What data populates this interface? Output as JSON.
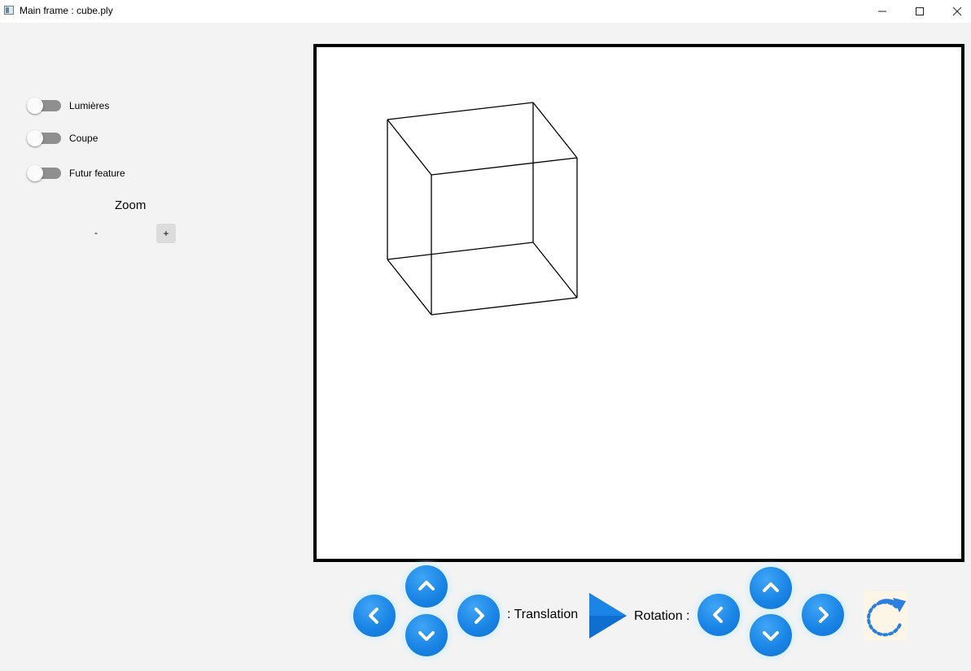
{
  "window": {
    "title": "Main frame : cube.ply",
    "minimize_glyph": "—",
    "maximize_glyph": "☐",
    "close_glyph": "✕"
  },
  "sidebar": {
    "toggles": [
      {
        "label": "Lumières",
        "on": false
      },
      {
        "label": "Coupe",
        "on": false
      },
      {
        "label": "Futur feature",
        "on": false
      }
    ],
    "zoom": {
      "label": "Zoom",
      "minus": "-",
      "plus": "+"
    }
  },
  "viewport": {
    "model": "cube",
    "render_mode": "wireframe",
    "stroke_color": "#000000"
  },
  "controls": {
    "translation_label": ": Translation",
    "rotation_label": "Rotation :",
    "button_color": "#1a85e6",
    "icons": {
      "left": "chevron-left-icon",
      "up": "chevron-up-icon",
      "down": "chevron-down-icon",
      "right": "chevron-right-icon",
      "play": "play-icon",
      "reset": "reset-rotation-icon"
    }
  }
}
